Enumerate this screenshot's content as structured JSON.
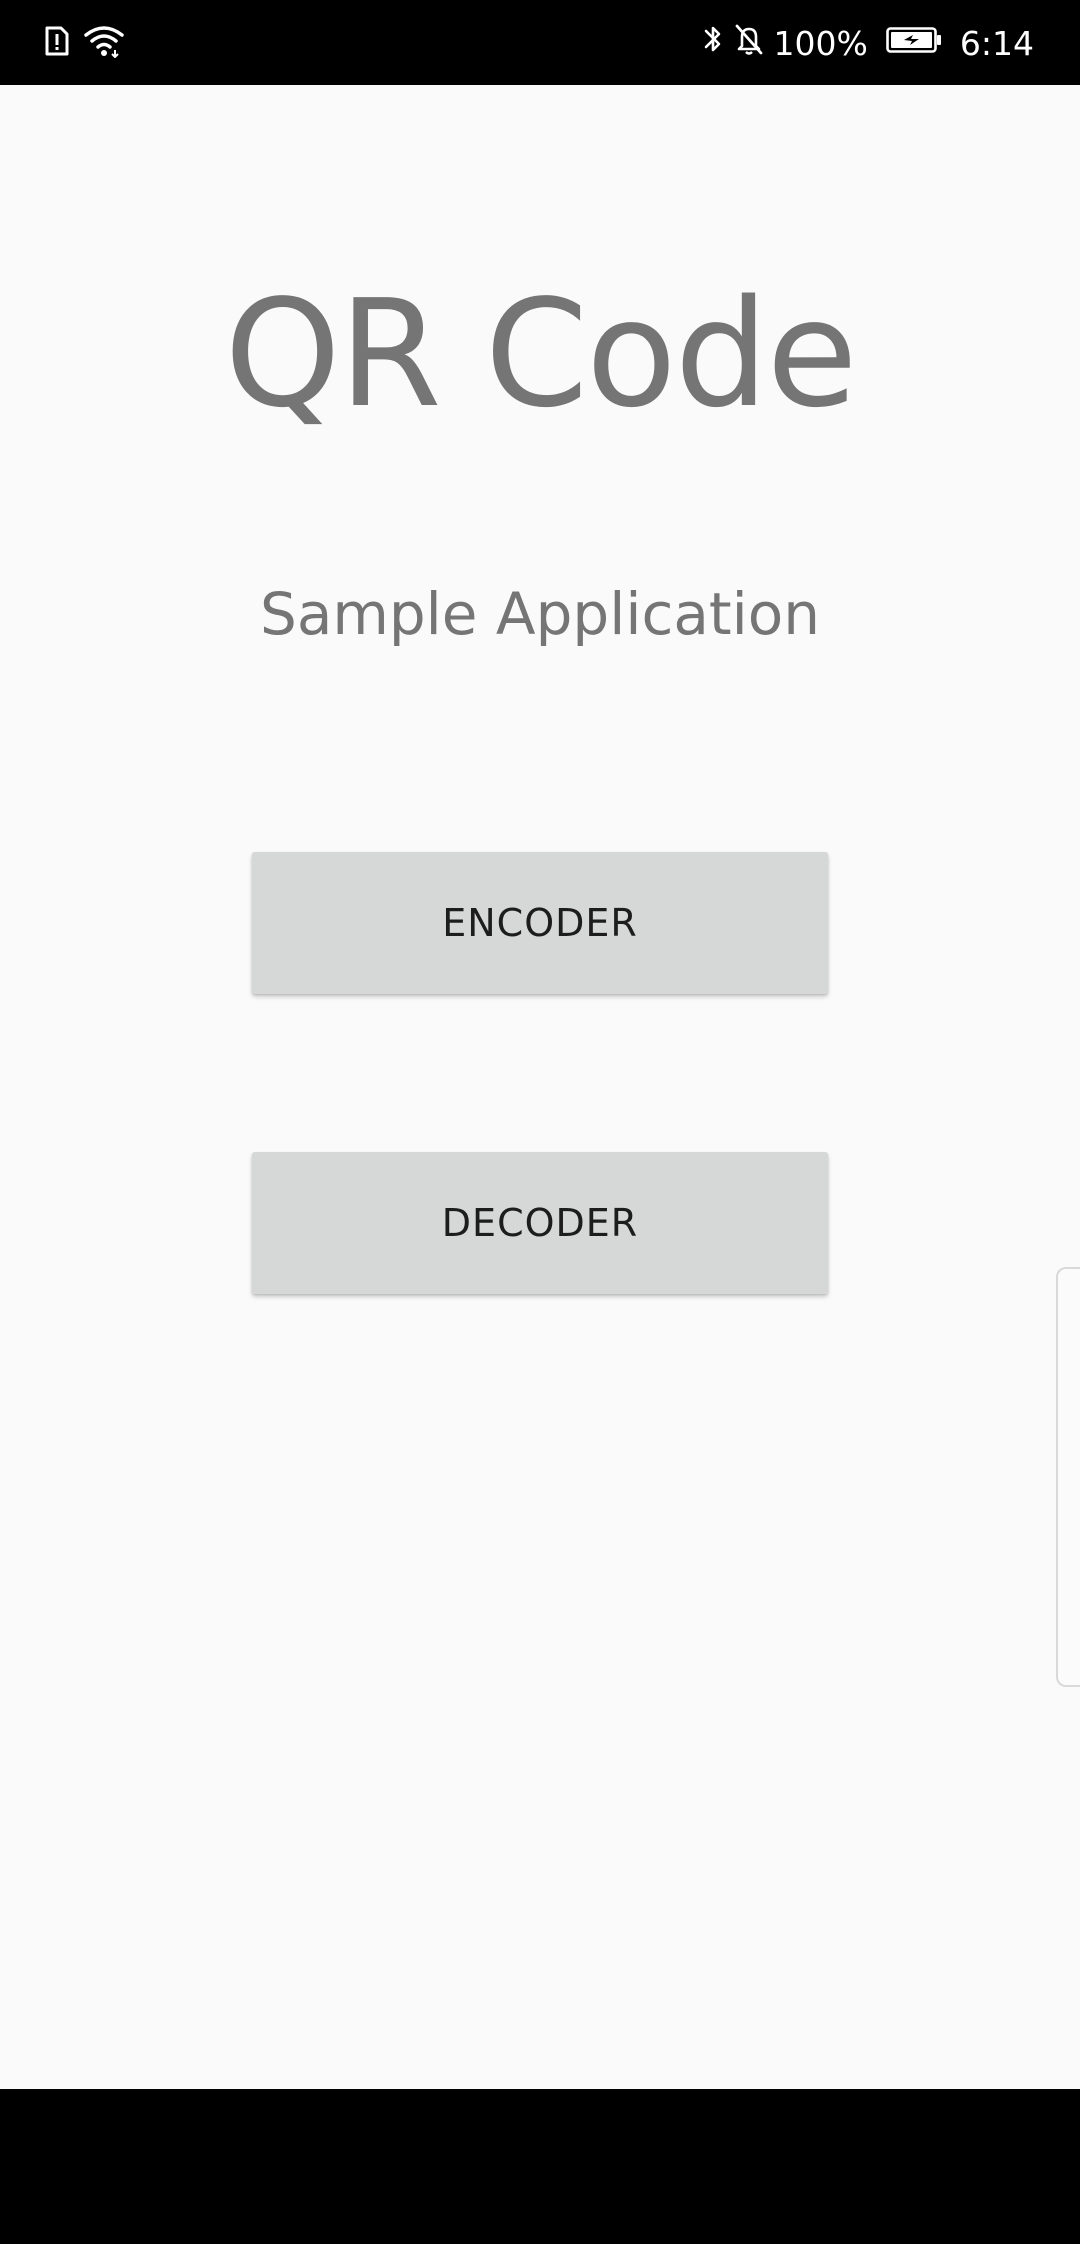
{
  "status_bar": {
    "left_icons": [
      "sim-alert-icon",
      "wifi-icon"
    ],
    "right_icons": [
      "bluetooth-icon",
      "mute-bell-icon",
      "battery-charging-icon"
    ],
    "battery_percent": "100%",
    "time": "6:14"
  },
  "app": {
    "title": "QR Code",
    "subtitle": "Sample Application",
    "buttons": {
      "encoder_label": "ENCODER",
      "decoder_label": "DECODER"
    }
  },
  "colors": {
    "background": "#fafafa",
    "title_text": "#757575",
    "button_bg": "#d6d7d7",
    "button_text": "#1d1d1d",
    "system_bars": "#000000"
  }
}
